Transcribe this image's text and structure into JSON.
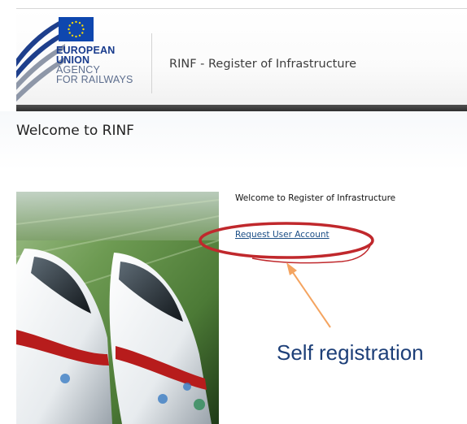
{
  "header": {
    "agency_lines": [
      "EUROPEAN",
      "UNION",
      "AGENCY",
      "FOR RAILWAYS"
    ],
    "app_title": "RINF - Register of Infrastructure"
  },
  "band": {
    "title": "Welcome to RINF"
  },
  "main": {
    "welcome_text": "Welcome to Register of Infrastructure",
    "request_link": "Request User Account"
  },
  "annotation": {
    "label": "Self registration"
  },
  "colors": {
    "eu_blue": "#0f47af",
    "eu_star": "#ffdd00",
    "link": "#1a4d85",
    "annotation_ellipse": "#c0282c",
    "annotation_arrow": "#f4a460",
    "annotation_text": "#1d3f78"
  }
}
